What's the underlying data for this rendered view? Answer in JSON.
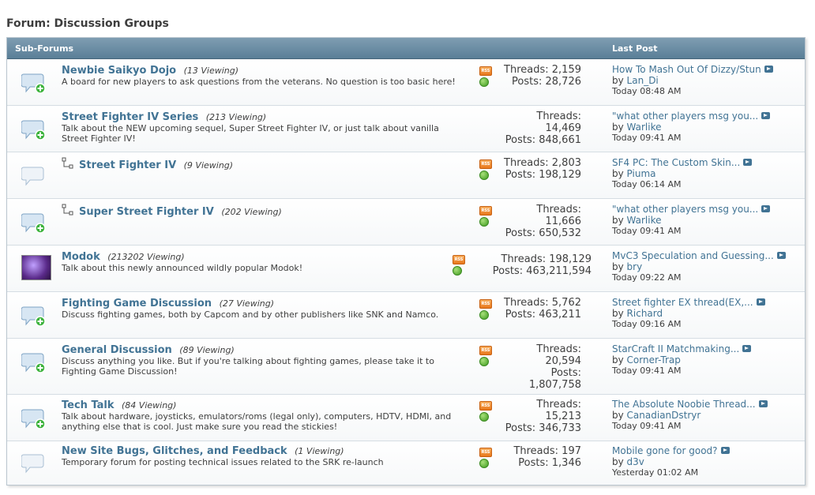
{
  "page": {
    "title": "Forum: Discussion Groups"
  },
  "header": {
    "sub_forums": "Sub-Forums",
    "last_post": "Last Post"
  },
  "forums": [
    {
      "name": "Newbie Saikyo Dojo",
      "viewing": "(13 Viewing)",
      "description": "A board for new players to ask questions from the veterans. No question is too basic here!",
      "threads": "Threads: 2,159",
      "posts": "Posts: 28,726",
      "last_post_title": "How To Mash Out Of Dizzy/Stun",
      "by": "by",
      "last_post_user": "Lan_Di",
      "last_post_time": "Today 08:48 AM",
      "icon": "chat-bubble-plus-icon"
    },
    {
      "name": "Street Fighter IV Series",
      "viewing": "(213 Viewing)",
      "description": "Talk about the NEW upcoming sequel, Super Street Fighter IV, or just talk about vanilla Street Fighter IV!",
      "threads": "Threads:",
      "threads_count": "14,469",
      "posts": "Posts: 848,661",
      "last_post_title": "\"what other players msg you...",
      "by": "by",
      "last_post_user": "Warlike",
      "last_post_time": "Today 09:41 AM",
      "icon": "chat-bubble-plus-icon"
    },
    {
      "name": "Street Fighter IV",
      "viewing": "(9 Viewing)",
      "description": "",
      "threads": "Threads: 2,803",
      "posts": "Posts: 198,129",
      "last_post_title": "SF4 PC: The Custom Skin...",
      "by": "by",
      "last_post_user": "Piuma",
      "last_post_time": "Today 06:14 AM",
      "icon": "chat-bubble-icon"
    },
    {
      "name": "Super Street Fighter IV",
      "viewing": "(202 Viewing)",
      "description": "",
      "threads": "Threads:",
      "threads_count": "11,666",
      "posts": "Posts: 650,532",
      "last_post_title": "\"what other players msg you...",
      "by": "by",
      "last_post_user": "Warlike",
      "last_post_time": "Today 09:41 AM",
      "icon": "chat-bubble-plus-icon"
    },
    {
      "name": "Modok",
      "viewing": "(213202 Viewing)",
      "description": "Talk about this newly announced  wildly popular Modok!",
      "threads": "Threads: 198,129",
      "posts": "Posts: 463,211,594",
      "last_post_title": "MvC3 Speculation and Guessing...",
      "by": "by",
      "last_post_user": "bry",
      "last_post_time": "Today 09:22 AM",
      "icon": "modok-image"
    },
    {
      "name": "Fighting Game Discussion",
      "viewing": "(27 Viewing)",
      "description": "Discuss fighting games, both by Capcom and by other publishers like SNK and Namco.",
      "threads": "Threads: 5,762",
      "posts": "Posts: 463,211",
      "last_post_title": "Street fighter EX thread(EX,...",
      "by": "by",
      "last_post_user": "Richard",
      "last_post_time": "Today 09:16 AM",
      "icon": "chat-bubble-plus-icon"
    },
    {
      "name": "General Discussion",
      "viewing": "(89 Viewing)",
      "description": "Discuss anything you like. But if you're talking about fighting games, please take it to Fighting Game Discussion!",
      "threads": "Threads:",
      "threads_count": "20,594",
      "posts": "Posts:",
      "posts_count": "1,807,758",
      "last_post_title": "StarCraft II Matchmaking...",
      "by": "by",
      "last_post_user": "Corner-Trap",
      "last_post_time": "Today 09:41 AM",
      "icon": "chat-bubble-plus-icon"
    },
    {
      "name": "Tech Talk",
      "viewing": "(84 Viewing)",
      "description": "Talk about hardware, joysticks, emulators/roms (legal only), computers, HDTV, HDMI, and anything else that is cool. Just make sure you read the stickies!",
      "threads": "Threads:",
      "threads_count": "15,213",
      "posts": "Posts: 346,733",
      "last_post_title": "The Absolute Noobie Thread...",
      "by": "by",
      "last_post_user": "CanadianDstryr",
      "last_post_time": "Today 09:41 AM",
      "icon": "chat-bubble-plus-icon"
    },
    {
      "name": "New Site Bugs, Glitches, and Feedback",
      "viewing": "(1 Viewing)",
      "description": "Temporary forum for posting technical issues related to the SRK re-launch",
      "threads": "Threads: 197",
      "posts": "Posts: 1,346",
      "last_post_title": "Mobile gone for good?",
      "by": "by",
      "last_post_user": "d3v",
      "last_post_time": "Yesterday 01:02 AM",
      "icon": "chat-bubble-icon"
    }
  ]
}
